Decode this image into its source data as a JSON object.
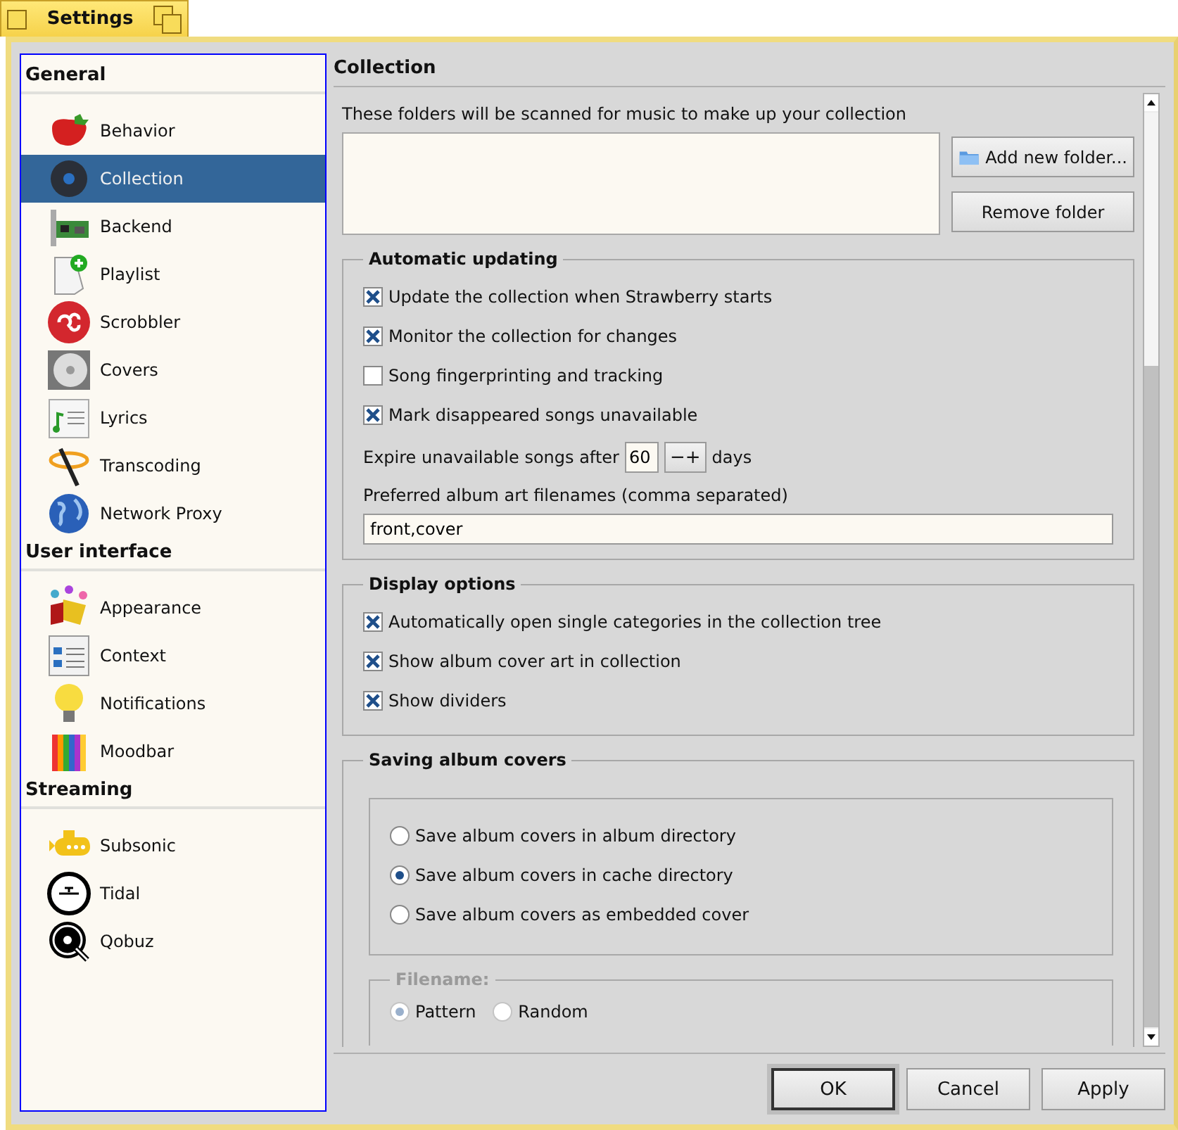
{
  "window": {
    "title": "Settings"
  },
  "sidebar": {
    "sections": [
      {
        "title": "General",
        "items": [
          {
            "label": "Behavior",
            "selected": false
          },
          {
            "label": "Collection",
            "selected": true
          },
          {
            "label": "Backend",
            "selected": false
          },
          {
            "label": "Playlist",
            "selected": false
          },
          {
            "label": "Scrobbler",
            "selected": false
          },
          {
            "label": "Covers",
            "selected": false
          },
          {
            "label": "Lyrics",
            "selected": false
          },
          {
            "label": "Transcoding",
            "selected": false
          },
          {
            "label": "Network Proxy",
            "selected": false
          }
        ]
      },
      {
        "title": "User interface",
        "items": [
          {
            "label": "Appearance",
            "selected": false
          },
          {
            "label": "Context",
            "selected": false
          },
          {
            "label": "Notifications",
            "selected": false
          },
          {
            "label": "Moodbar",
            "selected": false
          }
        ]
      },
      {
        "title": "Streaming",
        "items": [
          {
            "label": "Subsonic",
            "selected": false
          },
          {
            "label": "Tidal",
            "selected": false
          },
          {
            "label": "Qobuz",
            "selected": false
          }
        ]
      }
    ]
  },
  "page": {
    "title": "Collection",
    "folders": {
      "description": "These folders will be scanned for music to make up your collection",
      "add_button": "Add new folder...",
      "remove_button": "Remove folder"
    },
    "groups": [
      {
        "title": "Automatic updating",
        "rows": [
          {
            "kind": "checkbox",
            "label": "Update the collection when Strawberry starts",
            "checked": true
          },
          {
            "kind": "checkbox",
            "label": "Monitor the collection for changes",
            "checked": true
          },
          {
            "kind": "checkbox",
            "label": "Song fingerprinting and tracking",
            "checked": false
          },
          {
            "kind": "checkbox",
            "label": "Mark disappeared songs unavailable",
            "checked": true
          },
          {
            "kind": "spin",
            "label": "Expire unavailable songs after",
            "value": "60",
            "buttons": [
              "−",
              "+"
            ],
            "suffix": "days"
          },
          {
            "kind": "text",
            "label": "Preferred album art filenames (comma separated)",
            "value": "front,cover"
          }
        ]
      },
      {
        "title": "Display options",
        "rows": [
          {
            "kind": "checkbox",
            "label": "Automatically open single categories in the collection tree",
            "checked": true
          },
          {
            "kind": "checkbox",
            "label": "Show album cover art in collection",
            "checked": true
          },
          {
            "kind": "checkbox",
            "label": "Show dividers",
            "checked": true
          }
        ]
      },
      {
        "title": "Saving album covers",
        "rows": [
          {
            "kind": "radios",
            "options": [
              {
                "label": "Save album covers in album directory",
                "selected": false
              },
              {
                "label": "Save album covers in cache directory",
                "selected": true
              },
              {
                "label": "Save album covers as embedded cover",
                "selected": false
              }
            ]
          },
          {
            "kind": "subgroup",
            "title": "Filename:",
            "disabled": true,
            "options": [
              {
                "label": "Pattern",
                "selected": true
              },
              {
                "label": "Random",
                "selected": false
              }
            ]
          }
        ]
      }
    ]
  },
  "buttons": [
    {
      "label": "OK",
      "default": true
    },
    {
      "label": "Cancel",
      "default": false
    },
    {
      "label": "Apply",
      "default": false
    }
  ]
}
